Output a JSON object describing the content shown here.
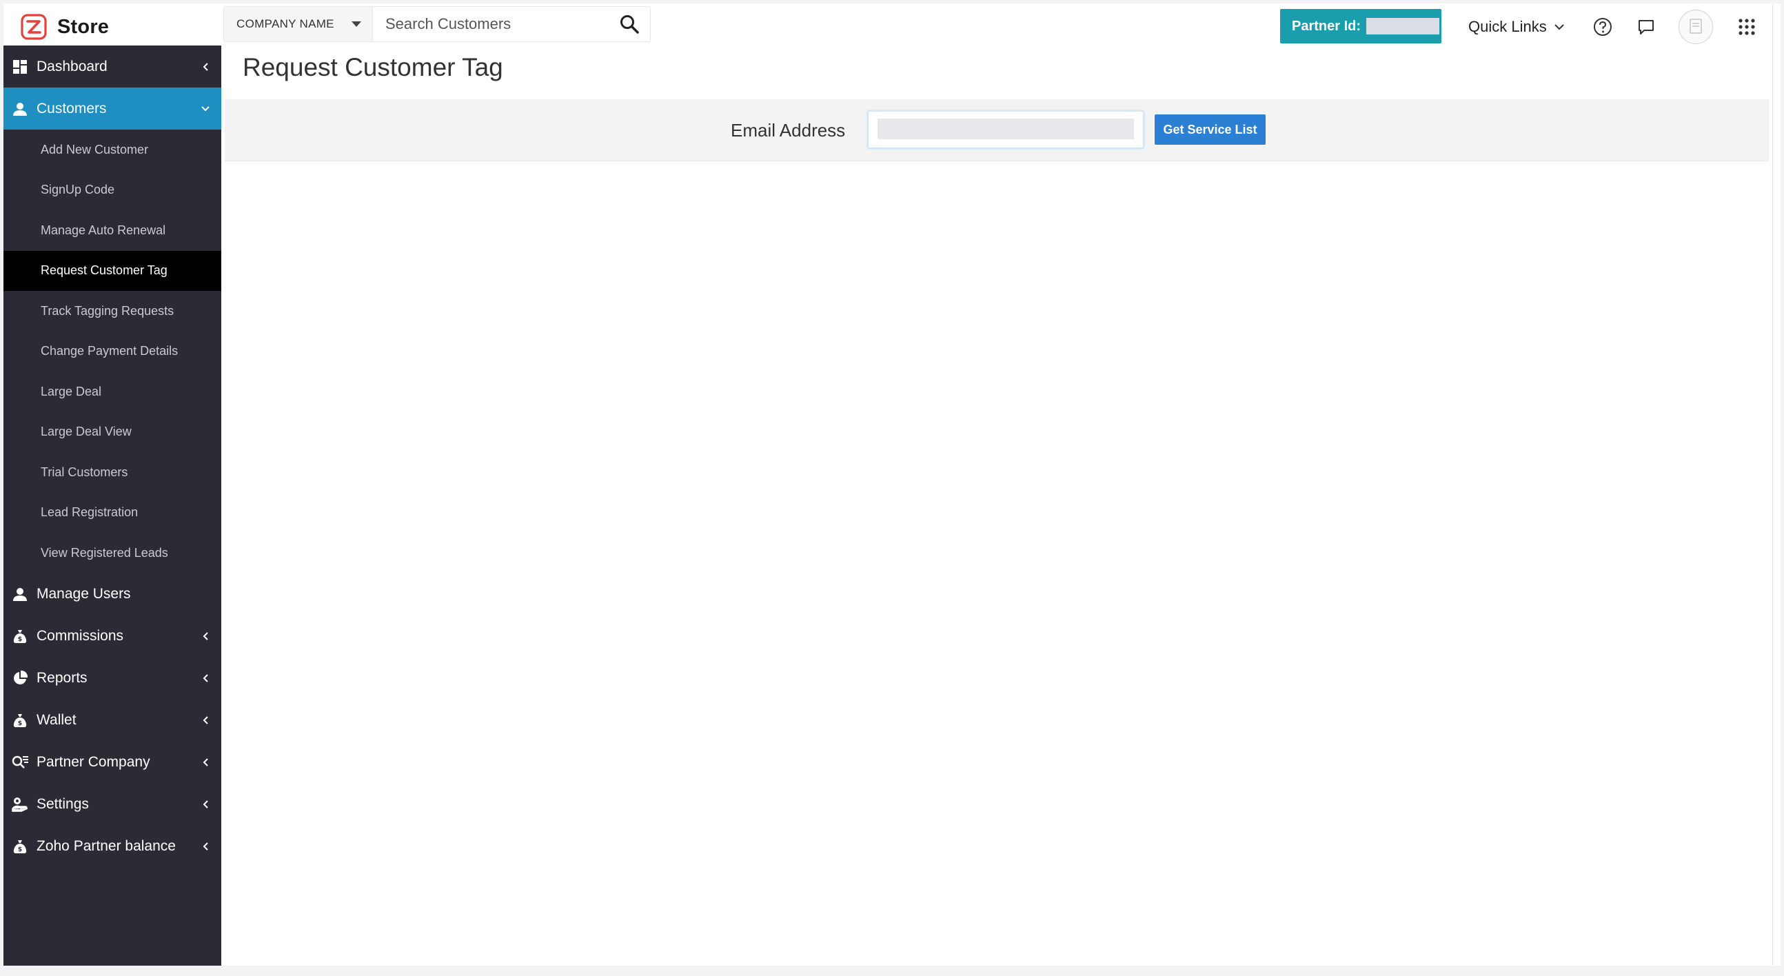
{
  "app": {
    "brand_name": "Store",
    "brand_color": "#e4423c"
  },
  "header": {
    "company_select_label": "COMPANY NAME",
    "search_placeholder": "Search Customers",
    "partner_id_label": "Partner Id:",
    "quick_links_label": "Quick Links",
    "accent": "#1a9ead",
    "icons": [
      "search-icon",
      "help-icon",
      "chat-icon",
      "avatar",
      "apps-grid-icon"
    ]
  },
  "sidebar": {
    "items": [
      {
        "label": "Dashboard",
        "icon": "dashboard-icon",
        "chevron": "left"
      },
      {
        "label": "Customers",
        "icon": "user-icon",
        "chevron": "down",
        "active": true
      },
      {
        "label": "Manage Users",
        "icon": "user-icon"
      },
      {
        "label": "Commissions",
        "icon": "money-bag-icon",
        "chevron": "left"
      },
      {
        "label": "Reports",
        "icon": "pie-chart-icon",
        "chevron": "left"
      },
      {
        "label": "Wallet",
        "icon": "money-bag-icon",
        "chevron": "left"
      },
      {
        "label": "Partner Company",
        "icon": "company-search-icon",
        "chevron": "left"
      },
      {
        "label": "Settings",
        "icon": "settings-hand-icon",
        "chevron": "left"
      },
      {
        "label": "Zoho Partner balance",
        "icon": "money-bag-icon",
        "chevron": "left"
      }
    ],
    "customers_submenu": [
      {
        "label": "Add New Customer"
      },
      {
        "label": "SignUp Code"
      },
      {
        "label": "Manage Auto Renewal"
      },
      {
        "label": "Request Customer Tag",
        "selected": true
      },
      {
        "label": "Track Tagging Requests"
      },
      {
        "label": "Change Payment Details"
      },
      {
        "label": "Large Deal"
      },
      {
        "label": "Large Deal View"
      },
      {
        "label": "Trial Customers"
      },
      {
        "label": "Lead Registration"
      },
      {
        "label": "View Registered Leads"
      }
    ],
    "colors": {
      "background": "#2b2b35",
      "active": "#1e8fc0",
      "selected": "#000000"
    }
  },
  "main": {
    "page_title": "Request Customer Tag",
    "email_label": "Email Address",
    "email_value": "",
    "button_label": "Get Service List",
    "button_color": "#2c80d3"
  }
}
